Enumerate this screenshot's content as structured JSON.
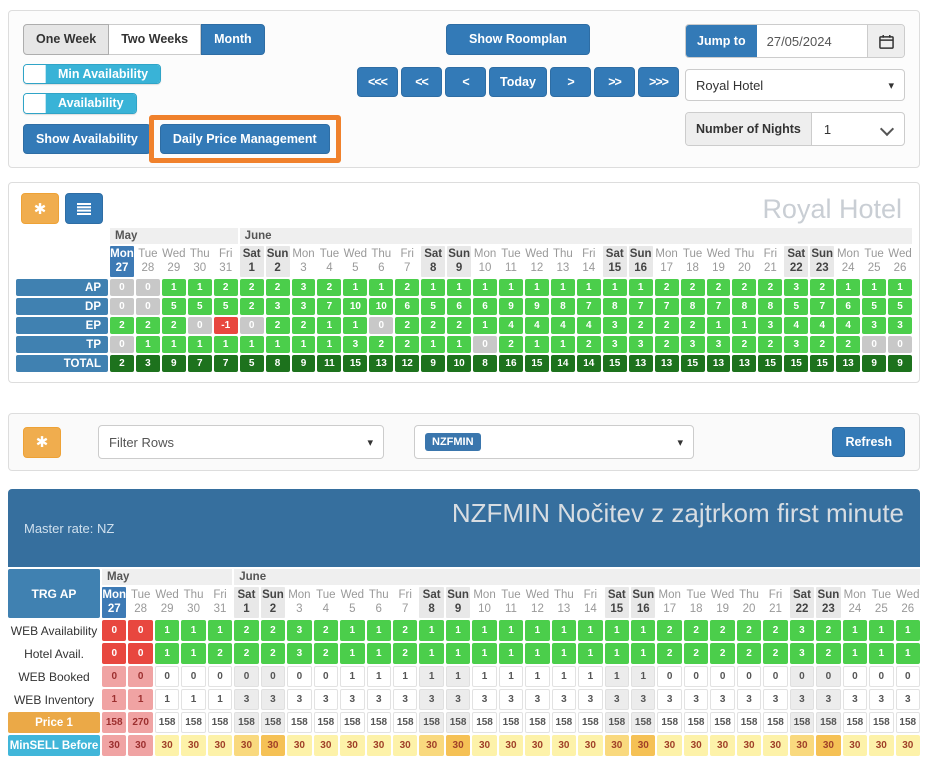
{
  "toolbar": {
    "view_buttons": [
      "One Week",
      "Two Weeks",
      "Month"
    ],
    "show_roomplan": "Show Roomplan",
    "nav": [
      "<<<",
      "<<",
      "<",
      "Today",
      ">",
      ">>",
      ">>>"
    ],
    "toggles": [
      "Min Availability",
      "Availability"
    ],
    "show_availability": "Show Availability",
    "daily_price_management": "Daily Price Management",
    "jump_to": "Jump to",
    "date_value": "27/05/2024",
    "hotel_select": "Royal Hotel",
    "nights_label": "Number of Nights",
    "nights_value": "1"
  },
  "icons": {
    "asterisk": "✱",
    "caret": "▾"
  },
  "calendar": {
    "months": [
      {
        "label": "May",
        "span": 5
      },
      {
        "label": "June",
        "span": 26
      }
    ],
    "days": [
      {
        "name": "Mon",
        "num": "27",
        "today": true
      },
      {
        "name": "Tue",
        "num": "28"
      },
      {
        "name": "Wed",
        "num": "29"
      },
      {
        "name": "Thu",
        "num": "30"
      },
      {
        "name": "Fri",
        "num": "31"
      },
      {
        "name": "Sat",
        "num": "1",
        "w": "sat"
      },
      {
        "name": "Sun",
        "num": "2",
        "w": "sun"
      },
      {
        "name": "Mon",
        "num": "3"
      },
      {
        "name": "Tue",
        "num": "4"
      },
      {
        "name": "Wed",
        "num": "5"
      },
      {
        "name": "Thu",
        "num": "6"
      },
      {
        "name": "Fri",
        "num": "7"
      },
      {
        "name": "Sat",
        "num": "8",
        "w": "sat"
      },
      {
        "name": "Sun",
        "num": "9",
        "w": "sun"
      },
      {
        "name": "Mon",
        "num": "10"
      },
      {
        "name": "Tue",
        "num": "11"
      },
      {
        "name": "Wed",
        "num": "12"
      },
      {
        "name": "Thu",
        "num": "13"
      },
      {
        "name": "Fri",
        "num": "14"
      },
      {
        "name": "Sat",
        "num": "15",
        "w": "sat"
      },
      {
        "name": "Sun",
        "num": "16",
        "w": "sun"
      },
      {
        "name": "Mon",
        "num": "17"
      },
      {
        "name": "Tue",
        "num": "18"
      },
      {
        "name": "Wed",
        "num": "19"
      },
      {
        "name": "Thu",
        "num": "20"
      },
      {
        "name": "Fri",
        "num": "21"
      },
      {
        "name": "Sat",
        "num": "22",
        "w": "sat"
      },
      {
        "name": "Sun",
        "num": "23",
        "w": "sun"
      },
      {
        "name": "Mon",
        "num": "24"
      },
      {
        "name": "Tue",
        "num": "25"
      },
      {
        "name": "Wed",
        "num": "26"
      }
    ]
  },
  "availability_table": {
    "title": "Royal Hotel",
    "rows": [
      {
        "label": "AP",
        "kind": "t1",
        "label_style": "blue",
        "editable": false,
        "values": [
          0,
          0,
          1,
          1,
          2,
          2,
          2,
          3,
          2,
          1,
          1,
          2,
          1,
          1,
          1,
          1,
          1,
          1,
          1,
          1,
          1,
          2,
          2,
          2,
          2,
          2,
          3,
          2,
          1,
          1,
          1
        ]
      },
      {
        "label": "DP",
        "kind": "t1",
        "label_style": "blue",
        "editable": false,
        "values": [
          0,
          0,
          5,
          5,
          5,
          2,
          3,
          3,
          7,
          10,
          10,
          6,
          5,
          6,
          6,
          9,
          9,
          8,
          7,
          8,
          7,
          7,
          8,
          7,
          8,
          8,
          5,
          7,
          6,
          5,
          5
        ]
      },
      {
        "label": "EP",
        "kind": "t1",
        "label_style": "blue",
        "editable": false,
        "values": [
          2,
          2,
          2,
          0,
          -1,
          0,
          2,
          2,
          1,
          1,
          0,
          2,
          2,
          2,
          1,
          4,
          4,
          4,
          4,
          3,
          2,
          2,
          2,
          1,
          1,
          3,
          4,
          4,
          4,
          3,
          3
        ]
      },
      {
        "label": "TP",
        "kind": "t1",
        "label_style": "blue",
        "editable": false,
        "values": [
          0,
          1,
          1,
          1,
          1,
          1,
          1,
          1,
          1,
          3,
          2,
          2,
          1,
          1,
          0,
          2,
          1,
          1,
          2,
          3,
          3,
          2,
          3,
          3,
          2,
          2,
          3,
          2,
          2,
          0,
          0
        ]
      },
      {
        "label": "TOTAL",
        "kind": "total",
        "label_style": "blue",
        "editable": false,
        "values": [
          2,
          3,
          9,
          7,
          7,
          5,
          8,
          9,
          11,
          15,
          13,
          12,
          9,
          10,
          8,
          16,
          15,
          14,
          14,
          15,
          13,
          13,
          15,
          13,
          13,
          15,
          15,
          15,
          13,
          9,
          9
        ]
      }
    ]
  },
  "filter": {
    "rows_placeholder": "Filter Rows",
    "rate_badge": "NZFMIN",
    "refresh_label": "Refresh"
  },
  "rate_table": {
    "master_rate": "Master rate: NZ",
    "title": "NZFMIN Nočitev z zajtrkom first minute",
    "corner": "TRG AP",
    "rows": [
      {
        "label": "WEB Availability",
        "kind": "avail",
        "label_style": "plain",
        "editable": true,
        "values": [
          0,
          0,
          1,
          1,
          1,
          2,
          2,
          3,
          2,
          1,
          1,
          2,
          1,
          1,
          1,
          1,
          1,
          1,
          1,
          1,
          1,
          2,
          2,
          2,
          2,
          2,
          3,
          2,
          1,
          1,
          1
        ]
      },
      {
        "label": "Hotel Avail.",
        "kind": "avail",
        "label_style": "plain",
        "editable": true,
        "values": [
          0,
          0,
          1,
          1,
          2,
          2,
          2,
          3,
          2,
          1,
          1,
          2,
          1,
          1,
          1,
          1,
          1,
          1,
          1,
          1,
          1,
          2,
          2,
          2,
          2,
          2,
          3,
          2,
          1,
          1,
          1
        ]
      },
      {
        "label": "WEB Booked",
        "kind": "plain",
        "label_style": "plain",
        "editable": true,
        "values": [
          0,
          0,
          0,
          0,
          0,
          0,
          0,
          0,
          0,
          1,
          1,
          1,
          1,
          1,
          1,
          1,
          1,
          1,
          1,
          1,
          1,
          0,
          0,
          0,
          0,
          0,
          0,
          0,
          0,
          0,
          0
        ]
      },
      {
        "label": "WEB Inventory",
        "kind": "plain",
        "label_style": "plain",
        "editable": true,
        "values": [
          1,
          1,
          1,
          1,
          1,
          3,
          3,
          3,
          3,
          3,
          3,
          3,
          3,
          3,
          3,
          3,
          3,
          3,
          3,
          3,
          3,
          3,
          3,
          3,
          3,
          3,
          3,
          3,
          3,
          3,
          3
        ]
      },
      {
        "label": "Price 1",
        "kind": "plain",
        "label_style": "orange",
        "editable": true,
        "values": [
          158,
          270,
          158,
          158,
          158,
          158,
          158,
          158,
          158,
          158,
          158,
          158,
          158,
          158,
          158,
          158,
          158,
          158,
          158,
          158,
          158,
          158,
          158,
          158,
          158,
          158,
          158,
          158,
          158,
          158,
          158
        ]
      },
      {
        "label": "MinSELL Before",
        "kind": "minsell",
        "label_style": "cyan",
        "editable": true,
        "values": [
          30,
          30,
          30,
          30,
          30,
          30,
          30,
          30,
          30,
          30,
          30,
          30,
          30,
          30,
          30,
          30,
          30,
          30,
          30,
          30,
          30,
          30,
          30,
          30,
          30,
          30,
          30,
          30,
          30,
          30,
          30
        ]
      }
    ]
  },
  "colors": {
    "primary_blue": "#337ab7",
    "toggle_cyan": "#39b3d7",
    "icon_orange": "#f0ad4e",
    "highlight_orange": "#f0812c",
    "row_label_blue": "#4081b1",
    "cell_green": "#4bce4b",
    "cell_dark_green": "#1d721d",
    "cell_red": "#e8473f",
    "cell_gray": "#c8c8c8",
    "cell_pink": "#f0a3a3",
    "minsell_yellow": "#fdf2a9",
    "rate_header_blue": "#366f9e"
  }
}
